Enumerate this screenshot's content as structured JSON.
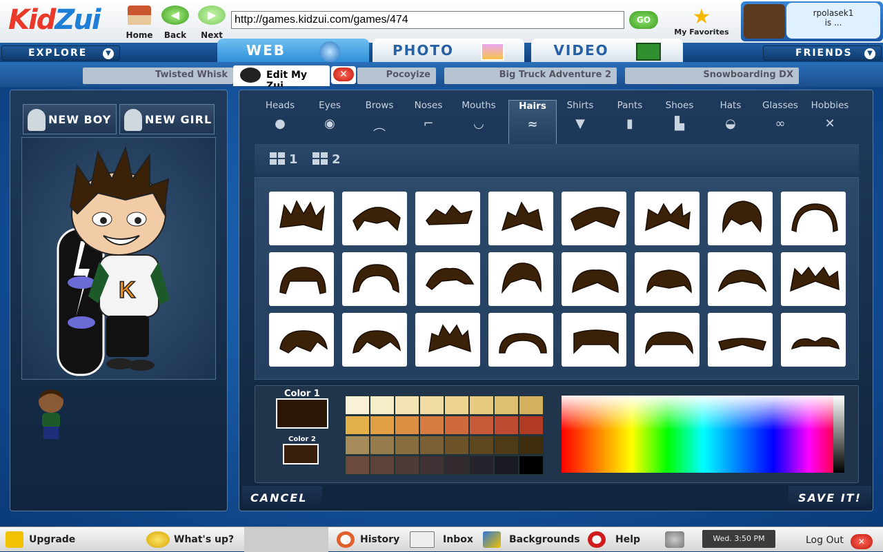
{
  "browser": {
    "logo_part1": "Kid",
    "logo_part2": "Zui",
    "nav": {
      "home": "Home",
      "back": "Back",
      "next": "Next"
    },
    "url": "http://games.kidzui.com/games/474",
    "go": "GO",
    "favorites": "My Favorites",
    "user": {
      "name": "rpolasek1",
      "status": "is ..."
    }
  },
  "menu": {
    "explore": "EXPLORE",
    "friends": "FRIENDS"
  },
  "tabs": {
    "web": "WEB",
    "photo": "PHOTO",
    "video": "VIDEO"
  },
  "page_tabs": {
    "active": "Edit My Zui",
    "others": [
      "Twisted Whisk",
      "Pocoyize",
      "Big Truck Adventure 2",
      "Snowboarding DX"
    ]
  },
  "left": {
    "new_boy": "NEW BOY",
    "new_girl": "NEW GIRL"
  },
  "categories": [
    {
      "label": "Heads",
      "icon": "head-icon"
    },
    {
      "label": "Eyes",
      "icon": "eye-icon"
    },
    {
      "label": "Brows",
      "icon": "brow-icon"
    },
    {
      "label": "Noses",
      "icon": "nose-icon"
    },
    {
      "label": "Mouths",
      "icon": "mouth-icon"
    },
    {
      "label": "Hairs",
      "icon": "hair-icon"
    },
    {
      "label": "Shirts",
      "icon": "shirt-icon"
    },
    {
      "label": "Pants",
      "icon": "pants-icon"
    },
    {
      "label": "Shoes",
      "icon": "shoes-icon"
    },
    {
      "label": "Hats",
      "icon": "hat-icon"
    },
    {
      "label": "Glasses",
      "icon": "glasses-icon"
    },
    {
      "label": "Hobbies",
      "icon": "hobbies-icon"
    }
  ],
  "active_category": "Hairs",
  "pages": [
    "1",
    "2"
  ],
  "color": {
    "color1_label": "Color 1",
    "color2_label": "Color 2",
    "color1": "#2b1608",
    "color2": "#3a200c",
    "swatches": [
      [
        "#f8f1d6",
        "#f5ecc8",
        "#f3e4b3",
        "#f0dca0",
        "#ecd38f",
        "#e8cb80",
        "#dfc06f",
        "#d4b15c"
      ],
      [
        "#e3b04a",
        "#e1a046",
        "#dc8e43",
        "#d67c40",
        "#cf6a3c",
        "#c85938",
        "#bf4a32",
        "#b03a22"
      ],
      [
        "#a58b5a",
        "#967b4c",
        "#886d3f",
        "#7a6034",
        "#6c532a",
        "#5e4621",
        "#4f3a18",
        "#3f2d10"
      ],
      [
        "#6a4a3a",
        "#5c4238",
        "#4e3a36",
        "#403234",
        "#332a30",
        "#26222b",
        "#1a1a22",
        "#000000"
      ]
    ]
  },
  "actions": {
    "cancel": "CANCEL",
    "save": "SAVE IT!"
  },
  "taskbar": {
    "upgrade": "Upgrade",
    "whats_up": "What's up?",
    "history": "History",
    "inbox": "Inbox",
    "backgrounds": "Backgrounds",
    "help": "Help",
    "clock": "Wed. 3:50 PM",
    "logout": "Log Out"
  }
}
